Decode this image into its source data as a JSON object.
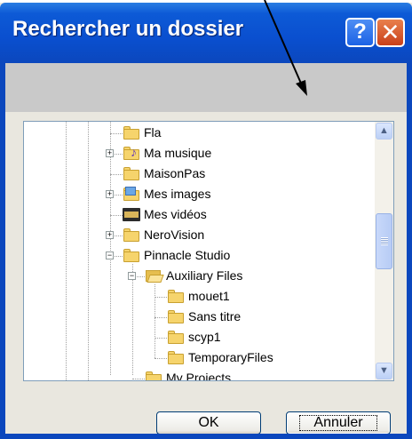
{
  "window": {
    "title": "Rechercher un dossier",
    "help_button": "?",
    "close_button": "✕"
  },
  "instructions": {
    "text": ""
  },
  "tree": {
    "items": [
      {
        "label": "Fla",
        "icon": "folder-icon",
        "expanded": null
      },
      {
        "label": "Ma musique",
        "icon": "music-folder-icon",
        "expanded": false
      },
      {
        "label": "MaisonPas",
        "icon": "folder-icon",
        "expanded": null
      },
      {
        "label": "Mes images",
        "icon": "pictures-folder-icon",
        "expanded": false
      },
      {
        "label": "Mes vidéos",
        "icon": "video-folder-icon",
        "expanded": null
      },
      {
        "label": "NeroVision",
        "icon": "folder-icon",
        "expanded": false
      },
      {
        "label": "Pinnacle Studio",
        "icon": "folder-icon",
        "expanded": true
      },
      {
        "label": "Auxiliary Files",
        "icon": "open-folder-icon",
        "expanded": true
      },
      {
        "label": "mouet1",
        "icon": "folder-icon",
        "expanded": null
      },
      {
        "label": "Sans titre",
        "icon": "folder-icon",
        "expanded": null
      },
      {
        "label": "scyp1",
        "icon": "folder-icon",
        "expanded": null
      },
      {
        "label": "TemporaryFiles",
        "icon": "folder-icon",
        "expanded": null
      },
      {
        "label": "My Projects",
        "icon": "folder-icon",
        "expanded": null
      }
    ],
    "expand_glyph": "+",
    "collapse_glyph": "−",
    "scroll_position": 0.45
  },
  "buttons": {
    "ok": "OK",
    "cancel": "Annuler"
  },
  "scrollbar": {
    "up_glyph": "▲",
    "down_glyph": "▼"
  },
  "colors": {
    "titlebar": "#0a4fcf",
    "frame": "#0b47bd",
    "face": "#e9e7df",
    "folder": "#f6d46c"
  }
}
